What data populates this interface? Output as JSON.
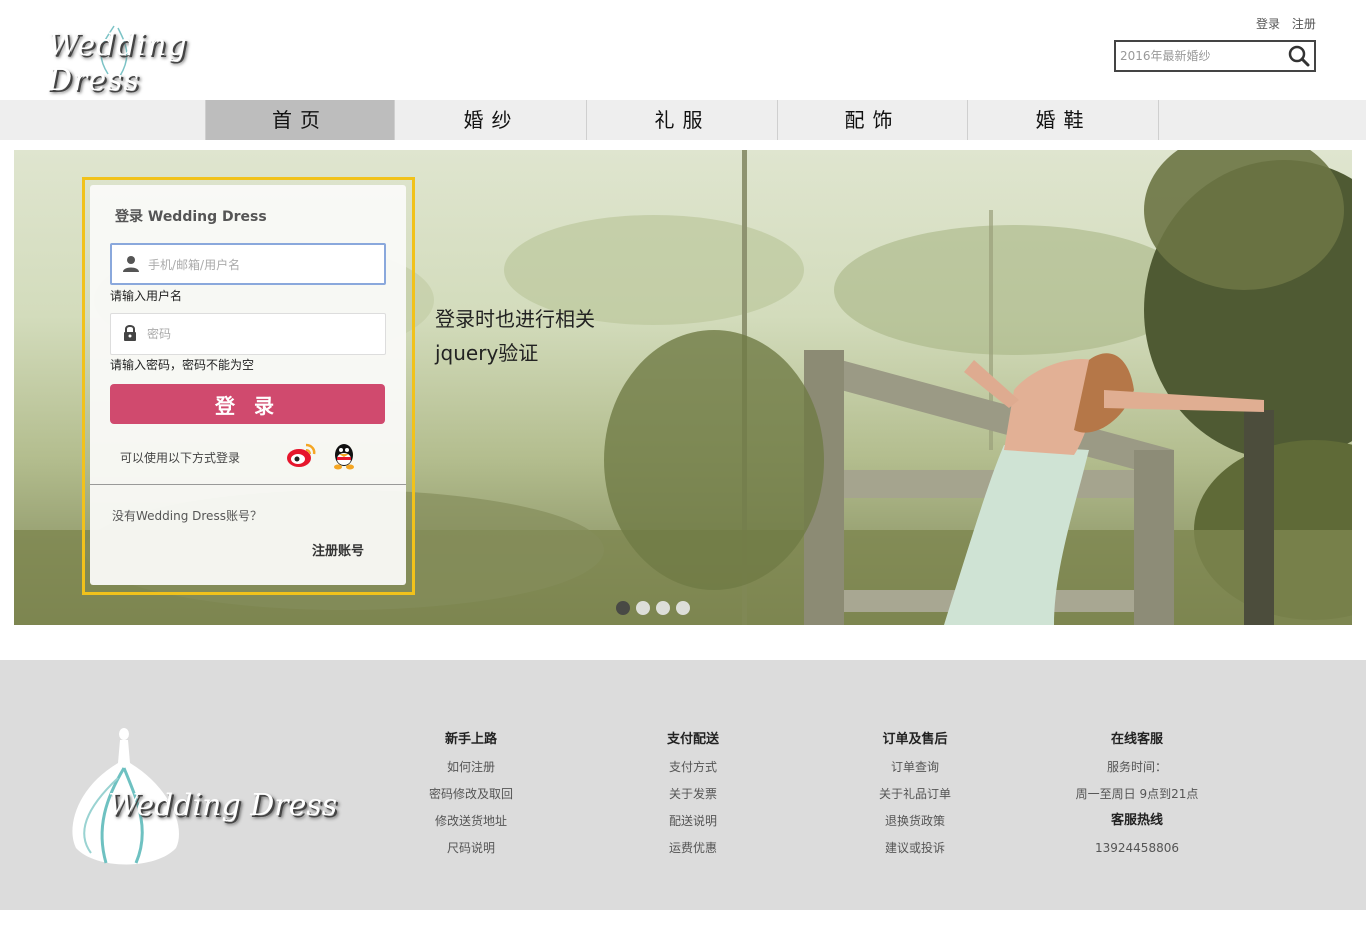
{
  "header": {
    "logo_text": "Wedding Dress",
    "top_links": [
      "登录",
      "注册"
    ],
    "search_placeholder": "2016年最新婚纱"
  },
  "nav": {
    "items": [
      "首页",
      "婚纱",
      "礼服",
      "配饰",
      "婚鞋"
    ],
    "active_index": 0
  },
  "banner": {
    "note_line1": "登录时也进行相关",
    "note_line2": "jquery验证",
    "slides": 4,
    "active_slide": 0
  },
  "login": {
    "title": "登录 Wedding Dress",
    "username_placeholder": "手机/邮箱/用户名",
    "username_hint": "请输入用户名",
    "password_placeholder": "密码",
    "password_hint": "请输入密码，密码不能为空",
    "submit_label": "登 录",
    "alt_login_text": "可以使用以下方式登录",
    "no_account_text": "没有Wedding Dress账号？",
    "register_label": "注册账号"
  },
  "footer": {
    "logo_text": "Wedding Dress",
    "columns": [
      {
        "title": "新手上路",
        "items": [
          "如何注册",
          "密码修改及取回",
          "修改送货地址",
          "尺码说明"
        ]
      },
      {
        "title": "支付配送",
        "items": [
          "支付方式",
          "关于发票",
          "配送说明",
          "运费优惠"
        ]
      },
      {
        "title": "订单及售后",
        "items": [
          "订单查询",
          "关于礼品订单",
          "退换货政策",
          "建议或投诉"
        ]
      },
      {
        "title": "在线客服",
        "service_label": "服务时间：",
        "service_hours": "周一至周日 9点到21点",
        "hotline_title": "客服热线",
        "hotline": "13924458806"
      }
    ]
  },
  "colors": {
    "accent_button": "#d04a6e",
    "highlight_frame": "#f1c21b",
    "nav_active": "#bdbdbd",
    "footer_bg": "#dcdcdc"
  }
}
